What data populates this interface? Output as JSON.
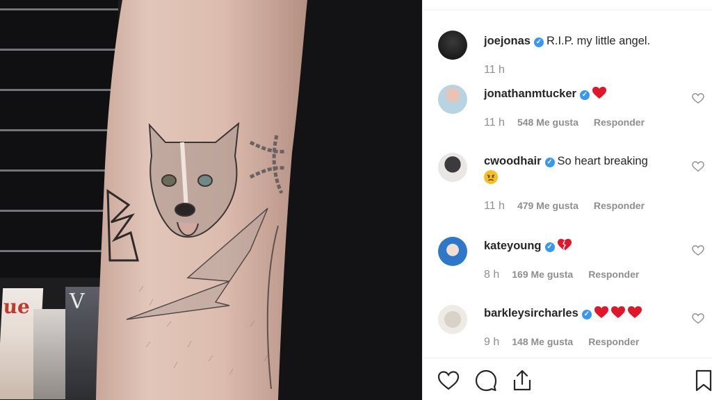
{
  "post": {
    "author": {
      "username": "joejonas",
      "caption": "R.I.P. my little angel.",
      "time": "11 h"
    }
  },
  "comments": [
    {
      "username": "jonathanmtucker",
      "text": "",
      "emoji": "red-heart",
      "time": "11 h",
      "likes": "548 Me gusta",
      "reply": "Responder"
    },
    {
      "username": "cwoodhair",
      "text": "So heart breaking",
      "emoji": "angry-face",
      "time": "11 h",
      "likes": "479 Me gusta",
      "reply": "Responder"
    },
    {
      "username": "kateyoung",
      "text": "",
      "emoji": "broken-heart",
      "time": "8 h",
      "likes": "169 Me gusta",
      "reply": "Responder"
    },
    {
      "username": "barkleysircharles",
      "text": "",
      "emoji": "three-red-hearts",
      "time": "9 h",
      "likes": "148 Me gusta",
      "reply": "Responder"
    }
  ],
  "photo": {
    "magazine_letters_left": "ue",
    "magazine_letters_right": "V"
  },
  "colors": {
    "verified": "#3897f0",
    "heart": "#ed4956",
    "muted_text": "#8e8e8e"
  },
  "icons": [
    "like-icon",
    "comment-icon",
    "share-icon",
    "save-icon",
    "verified-badge-icon",
    "comment-like-icon"
  ]
}
